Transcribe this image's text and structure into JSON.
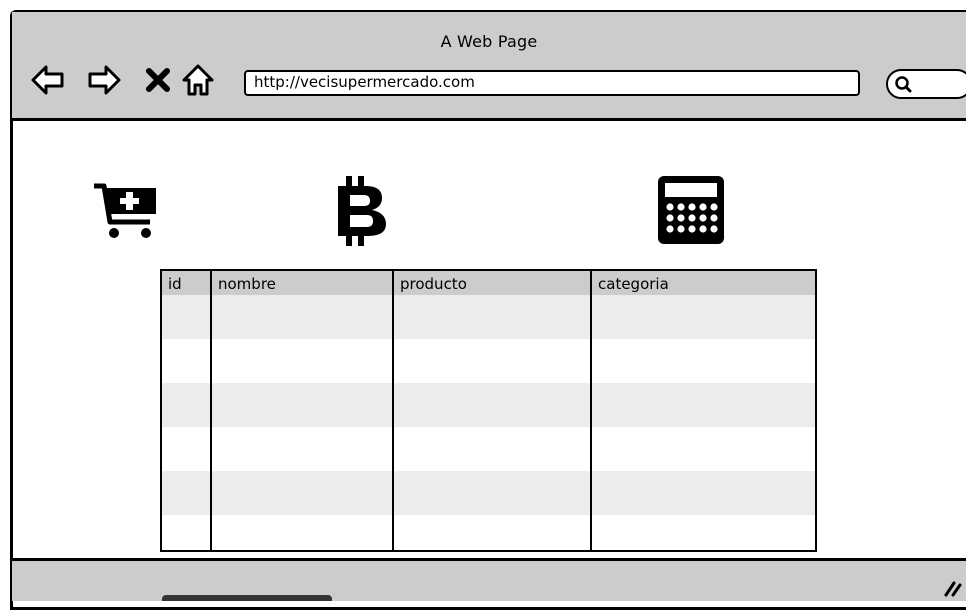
{
  "window": {
    "title": "A Web Page"
  },
  "toolbar": {
    "url": "http://vecisupermercado.com",
    "buttons": [
      "back-icon",
      "forward-icon",
      "stop-icon",
      "home-icon"
    ]
  },
  "content": {
    "icons": [
      "cart-plus-icon",
      "bitcoin-icon",
      "calculator-icon"
    ]
  },
  "table": {
    "columns": [
      "id",
      "nombre",
      "producto",
      "categoria"
    ],
    "rows": [
      [
        "",
        "",
        "",
        ""
      ],
      [
        "",
        "",
        "",
        ""
      ],
      [
        "",
        "",
        "",
        ""
      ],
      [
        "",
        "",
        "",
        ""
      ],
      [
        "",
        "",
        "",
        ""
      ],
      [
        "",
        "",
        "",
        ""
      ]
    ],
    "header_color": "#cccccc",
    "stripe_color": "#ececec"
  },
  "colors": {
    "chrome": "#cccccc",
    "ink": "#000000",
    "background": "#ffffff"
  }
}
